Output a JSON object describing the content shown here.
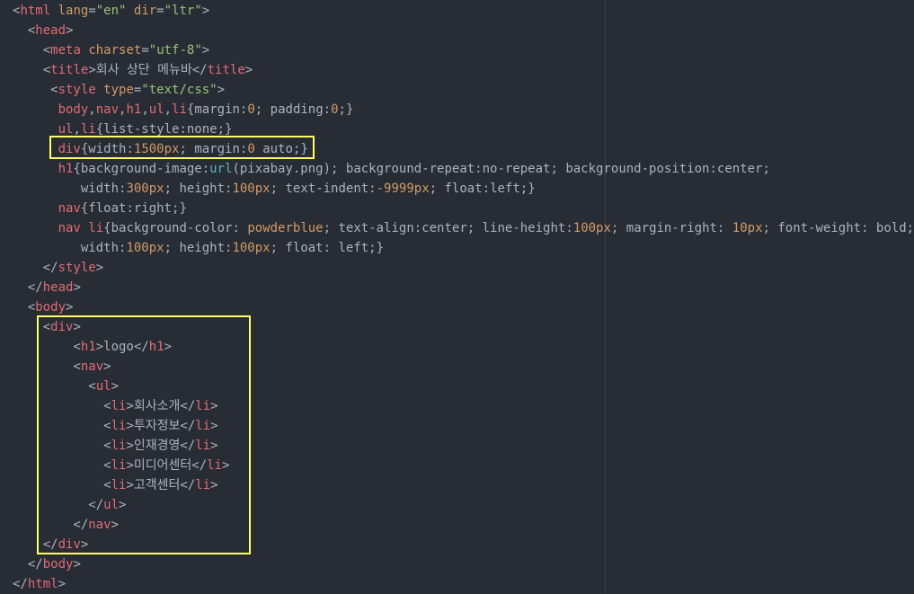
{
  "lines": [
    [
      [
        "p",
        "<"
      ],
      [
        "t",
        "html"
      ],
      [
        "p",
        " "
      ],
      [
        "a",
        "lang"
      ],
      [
        "p",
        "="
      ],
      [
        "s",
        "\"en\""
      ],
      [
        "p",
        " "
      ],
      [
        "a",
        "dir"
      ],
      [
        "p",
        "="
      ],
      [
        "s",
        "\"ltr\""
      ],
      [
        "p",
        ">"
      ]
    ],
    [
      [
        "p",
        "  <"
      ],
      [
        "t",
        "head"
      ],
      [
        "p",
        ">"
      ]
    ],
    [
      [
        "p",
        "    <"
      ],
      [
        "t",
        "meta"
      ],
      [
        "p",
        " "
      ],
      [
        "a",
        "charset"
      ],
      [
        "p",
        "="
      ],
      [
        "s",
        "\"utf-8\""
      ],
      [
        "p",
        ">"
      ]
    ],
    [
      [
        "p",
        "    <"
      ],
      [
        "t",
        "title"
      ],
      [
        "p",
        ">회사 상단 메뉴바</"
      ],
      [
        "t",
        "title"
      ],
      [
        "p",
        ">"
      ]
    ],
    [
      [
        "p",
        "     <"
      ],
      [
        "t",
        "style"
      ],
      [
        "p",
        " "
      ],
      [
        "a",
        "type"
      ],
      [
        "p",
        "="
      ],
      [
        "s",
        "\"text/css\""
      ],
      [
        "p",
        ">"
      ]
    ],
    [
      [
        "p",
        "      "
      ],
      [
        "sel",
        "body"
      ],
      [
        "p",
        ","
      ],
      [
        "sel",
        "nav"
      ],
      [
        "p",
        ","
      ],
      [
        "sel",
        "h1"
      ],
      [
        "p",
        ","
      ],
      [
        "sel",
        "ul"
      ],
      [
        "p",
        ","
      ],
      [
        "sel",
        "li"
      ],
      [
        "p",
        "{margin:"
      ],
      [
        "num",
        "0"
      ],
      [
        "p",
        "; padding:"
      ],
      [
        "num",
        "0"
      ],
      [
        "p",
        ";}"
      ]
    ],
    [
      [
        "p",
        "      "
      ],
      [
        "sel",
        "ul"
      ],
      [
        "p",
        ","
      ],
      [
        "sel",
        "li"
      ],
      [
        "p",
        "{list-style:none;}"
      ]
    ],
    [
      [
        "p",
        "      "
      ],
      [
        "sel",
        "div"
      ],
      [
        "p",
        "{width:"
      ],
      [
        "num",
        "1500px"
      ],
      [
        "p",
        "; margin:"
      ],
      [
        "num",
        "0"
      ],
      [
        "p",
        " auto;}"
      ]
    ],
    [
      [
        "p",
        "      "
      ],
      [
        "sel",
        "h1"
      ],
      [
        "p",
        "{background-image:"
      ],
      [
        "fn",
        "url"
      ],
      [
        "p",
        "(pixabay.png); background-repeat:no-repeat; background-position:center;"
      ]
    ],
    [
      [
        "p",
        "         width:"
      ],
      [
        "num",
        "300px"
      ],
      [
        "p",
        "; height:"
      ],
      [
        "num",
        "100px"
      ],
      [
        "p",
        "; text-indent:"
      ],
      [
        "num",
        "-9999px"
      ],
      [
        "p",
        "; float:left;}"
      ]
    ],
    [
      [
        "p",
        "      "
      ],
      [
        "sel",
        "nav"
      ],
      [
        "p",
        "{float:right;}"
      ]
    ],
    [
      [
        "p",
        "      "
      ],
      [
        "sel",
        "nav li"
      ],
      [
        "p",
        "{background-color: "
      ],
      [
        "num",
        "powderblue"
      ],
      [
        "p",
        "; text-align:center; line-height:"
      ],
      [
        "num",
        "100px"
      ],
      [
        "p",
        "; margin-right: "
      ],
      [
        "num",
        "10px"
      ],
      [
        "p",
        "; font-weight: bold;"
      ]
    ],
    [
      [
        "p",
        "         width:"
      ],
      [
        "num",
        "100px"
      ],
      [
        "p",
        "; height:"
      ],
      [
        "num",
        "100px"
      ],
      [
        "p",
        "; float: left;}"
      ]
    ],
    [
      [
        "p",
        "    </"
      ],
      [
        "t",
        "style"
      ],
      [
        "p",
        ">"
      ]
    ],
    [
      [
        "p",
        "  </"
      ],
      [
        "t",
        "head"
      ],
      [
        "p",
        ">"
      ]
    ],
    [
      [
        "p",
        "  <"
      ],
      [
        "t",
        "body"
      ],
      [
        "p",
        ">"
      ]
    ],
    [
      [
        "p",
        "    <"
      ],
      [
        "t",
        "div"
      ],
      [
        "p",
        ">"
      ]
    ],
    [
      [
        "p",
        "        <"
      ],
      [
        "t",
        "h1"
      ],
      [
        "p",
        ">logo</"
      ],
      [
        "t",
        "h1"
      ],
      [
        "p",
        ">"
      ]
    ],
    [
      [
        "p",
        "        <"
      ],
      [
        "t",
        "nav"
      ],
      [
        "p",
        ">"
      ]
    ],
    [
      [
        "p",
        "          <"
      ],
      [
        "t",
        "ul"
      ],
      [
        "p",
        ">"
      ]
    ],
    [
      [
        "p",
        "            <"
      ],
      [
        "t",
        "li"
      ],
      [
        "p",
        ">회사소개</"
      ],
      [
        "t",
        "li"
      ],
      [
        "p",
        ">"
      ]
    ],
    [
      [
        "p",
        "            <"
      ],
      [
        "t",
        "li"
      ],
      [
        "p",
        ">투자정보</"
      ],
      [
        "t",
        "li"
      ],
      [
        "p",
        ">"
      ]
    ],
    [
      [
        "p",
        "            <"
      ],
      [
        "t",
        "li"
      ],
      [
        "p",
        ">인재경영</"
      ],
      [
        "t",
        "li"
      ],
      [
        "p",
        ">"
      ]
    ],
    [
      [
        "p",
        "            <"
      ],
      [
        "t",
        "li"
      ],
      [
        "p",
        ">미디어센터</"
      ],
      [
        "t",
        "li"
      ],
      [
        "p",
        ">"
      ]
    ],
    [
      [
        "p",
        "            <"
      ],
      [
        "t",
        "li"
      ],
      [
        "p",
        ">고객센터</"
      ],
      [
        "t",
        "li"
      ],
      [
        "p",
        ">"
      ]
    ],
    [
      [
        "p",
        "          </"
      ],
      [
        "t",
        "ul"
      ],
      [
        "p",
        ">"
      ]
    ],
    [
      [
        "p",
        "        </"
      ],
      [
        "t",
        "nav"
      ],
      [
        "p",
        ">"
      ]
    ],
    [
      [
        "p",
        "    </"
      ],
      [
        "t",
        "div"
      ],
      [
        "p",
        ">"
      ]
    ],
    [
      [
        "p",
        "  </"
      ],
      [
        "t",
        "body"
      ],
      [
        "p",
        ">"
      ]
    ],
    [
      [
        "p",
        "</"
      ],
      [
        "t",
        "html"
      ],
      [
        "p",
        ">"
      ]
    ]
  ],
  "highlight_color": "#ffff66"
}
